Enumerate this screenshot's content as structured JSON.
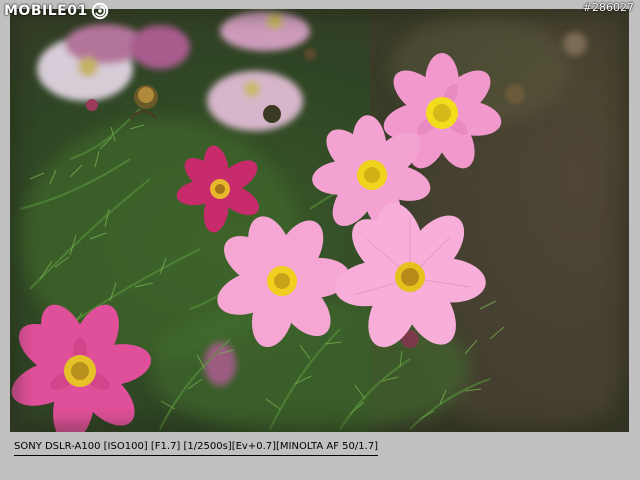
{
  "photo": {
    "logo_text": "MOBILE01",
    "photo_id": "#286027",
    "caption": "SONY DSLR-A100 [ISO100] [F1.7] [1/2500s][Ev+0.7][MINOLTA AF 50/1.7]",
    "subject": "pink cosmos flowers",
    "colors": {
      "page_background": "#c0c0c0",
      "foliage": "#3f6b2c",
      "petal_pink": "#f0a0c8",
      "petal_magenta": "#d2357e",
      "flower_center": "#f2d020",
      "background_blur": "#4a4630"
    }
  }
}
